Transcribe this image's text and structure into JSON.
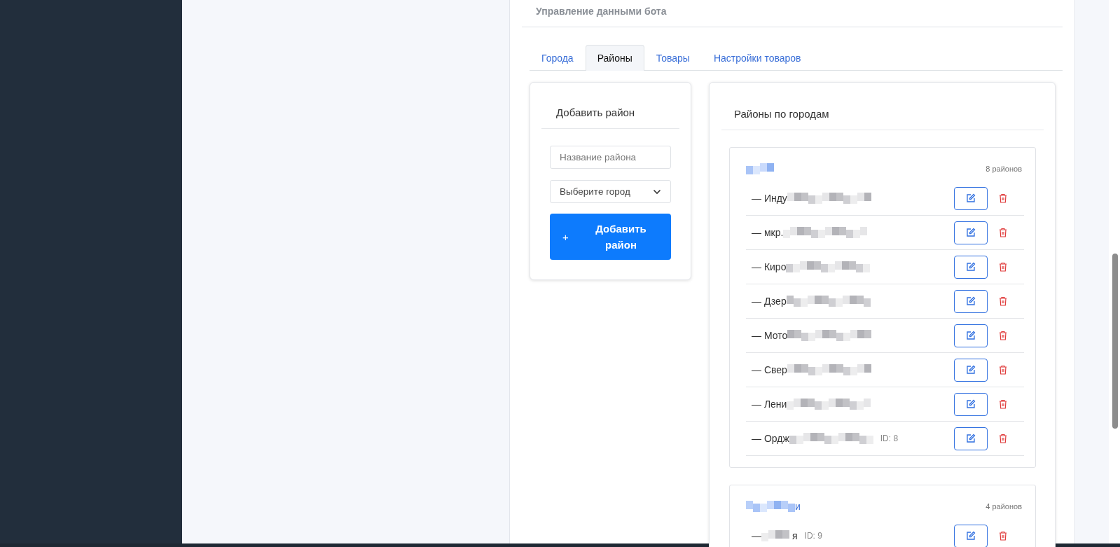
{
  "panel": {
    "title": "Управление данными бота"
  },
  "tabs": [
    {
      "label": "Города",
      "selected": false
    },
    {
      "label": "Районы",
      "selected": true
    },
    {
      "label": "Товары",
      "selected": false
    },
    {
      "label": "Настройки товаров",
      "selected": false
    }
  ],
  "add_form": {
    "title": "Добавить район",
    "name_placeholder": "Название района",
    "city_select": "Выберите город",
    "button_icon": "+",
    "button_label": "Добавить район"
  },
  "districts": {
    "title": "Районы по городам",
    "groups": [
      {
        "count": "8 районов",
        "rows": [
          {
            "prefix": "— Инду"
          },
          {
            "prefix": "— мкр."
          },
          {
            "prefix": "— Киро"
          },
          {
            "prefix": "— Дзер"
          },
          {
            "prefix": "— Мото"
          },
          {
            "prefix": "— Свер"
          },
          {
            "prefix": "— Лени"
          },
          {
            "prefix": "— Ордж",
            "id": "ID: 8"
          }
        ]
      },
      {
        "name_tail": "и",
        "count": "4 районов",
        "rows": [
          {
            "prefix": "— ",
            "suffix": "я",
            "id": "ID: 9"
          }
        ]
      }
    ]
  }
}
